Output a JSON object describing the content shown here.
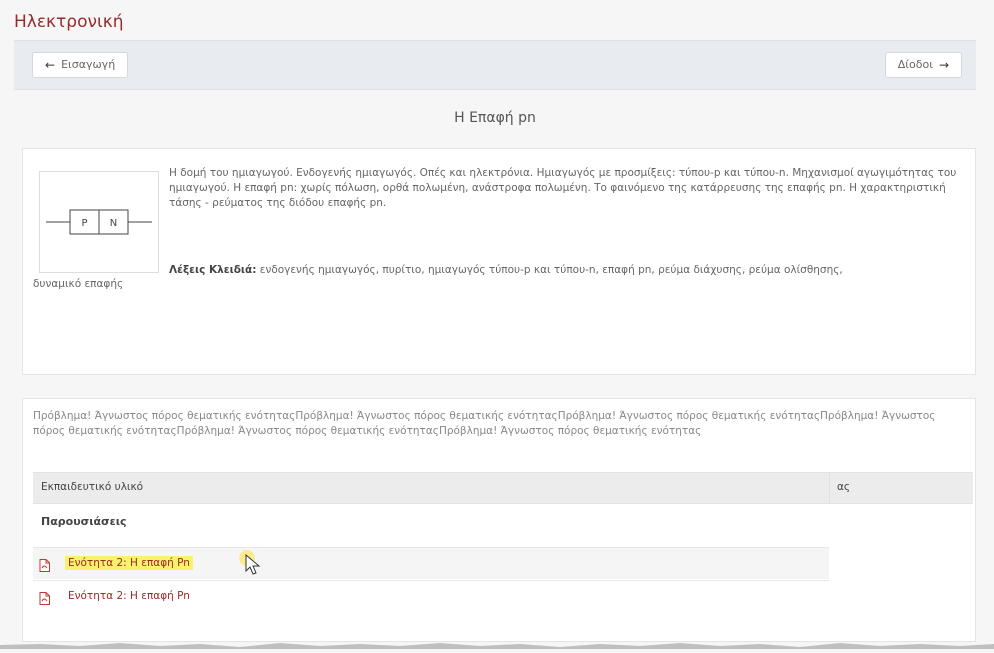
{
  "page": {
    "title": "Ηλεκτρονική"
  },
  "nav": {
    "prev_label": "Εισαγωγή",
    "next_label": "Δίοδοι",
    "prev_icon": "arrow-left-icon",
    "next_icon": "arrow-right-icon"
  },
  "unit": {
    "title": "Η Επαφή pn",
    "description": "Η δομή του ημιαγωγού. Ενδογενής ημιαγωγός. Οπές και ηλεκτρόνια. Ημιαγωγός με προσμίξεις: τύπου-p και τύπου-n. Μηχανισμοί αγωγιμότητας του ημιαγωγού. Η επαφή pn: χωρίς πόλωση, ορθά πολωμένη, ανάστροφα πολωμένη. Το φαινόμενο της κατάρρευσης της επαφής pn. Η χαρακτηριστική τάσης - ρεύματος της διόδου επαφής pn.",
    "keywords_label": "Λέξεις Κλειδιά:",
    "keywords": "ενδογενής ημιαγωγός, πυρίτιο, ημιαγωγός τύπου-p και τύπου-n, επαφή pn, ρεύμα διάχυσης, ρεύμα ολίσθησης,",
    "keywords_tail": "δυναμικό επαφής",
    "diagram_labels": [
      "P",
      "N"
    ]
  },
  "materials": {
    "error_text": "Πρόβλημα! Άγνωστος πόρος θεματικής ενότηταςΠρόβλημα! Άγνωστος πόρος θεματικής ενότηταςΠρόβλημα! Άγνωστος πόρος θεματικής ενότηταςΠρόβλημα! Άγνωστος πόρος θεματικής ενότηταςΠρόβλημα! Άγνωστος πόρος θεματικής ενότηταςΠρόβλημα! Άγνωστος πόρος θεματικής ενότητας",
    "table_header": "Εκπαιδευτικό υλικό",
    "table_header_col2": "ας",
    "section_title": "Παρουσιάσεις",
    "files": [
      {
        "label": "Ενότητα 2: Η επαφή Pn",
        "icon": "pdf-icon",
        "highlighted": true
      },
      {
        "label": "Ενότητα 2: Η επαφή Pn",
        "icon": "pdf-icon",
        "highlighted": false
      }
    ]
  },
  "colors": {
    "brand": "#9a2a2a",
    "highlight": "#f9f36b",
    "navbar_bg": "#e8ebef"
  }
}
